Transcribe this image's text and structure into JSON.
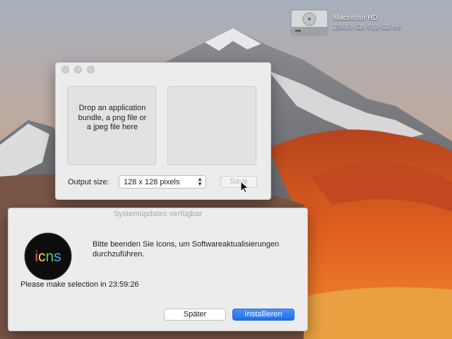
{
  "desktop": {
    "disk": {
      "icon": "hard-drive-icon",
      "name": "Macintosh HD",
      "info": "250,69 GB, 93,9 GB frei"
    }
  },
  "icon_window": {
    "drop_text": "Drop an application bundle, a png file or a jpeg file here",
    "output_label": "Output size:",
    "output_value": "128 x 128 pixels",
    "save_label": "Save"
  },
  "update_dialog": {
    "title": "Systemupdates verfügbar",
    "app_icon_text": "icns",
    "message": "Bitte beenden Sie Icons, um Softwareaktualisierungen durchzuführen.",
    "timer_text": "Please make selection in 23:59:26",
    "later_label": "Später",
    "install_label": "Installieren",
    "accent_color": "#1f6fe8"
  }
}
